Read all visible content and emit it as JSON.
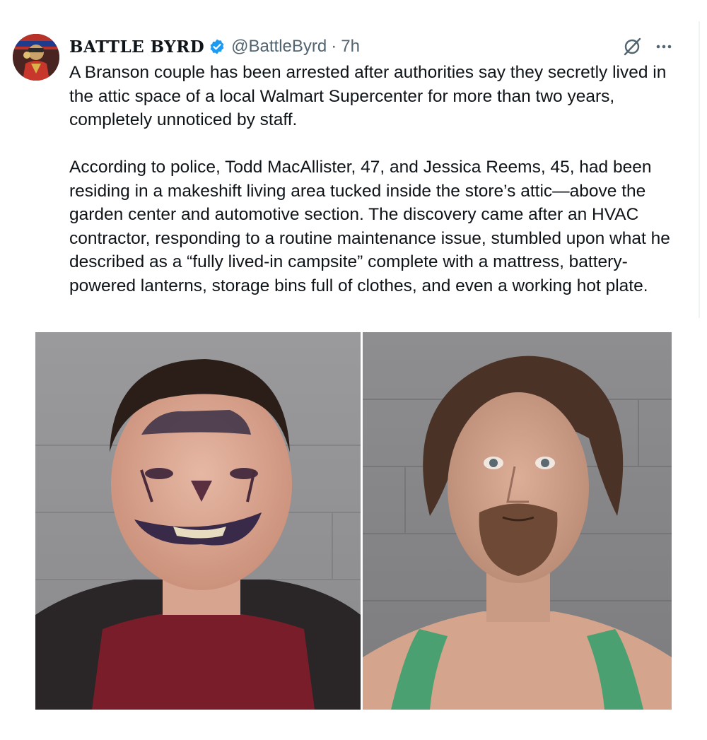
{
  "tweet": {
    "display_name": "BATTLE BYRD",
    "handle": "@BattleByrd",
    "separator": "·",
    "timestamp": "7h",
    "paragraphs": [
      "A Branson couple has been arrested after authorities say they secretly lived in the attic space of a local Walmart Supercenter for more than two years, completely unnoticed by staff.",
      "According to police, Todd MacAllister, 47, and Jessica Reems, 45, had been residing in a makeshift living area tucked inside the store’s attic—above the garden center and automotive section. The discovery came after an HVAC contractor, responding to a routine maintenance issue, stumbled upon what he described as a “fully lived-in campsite” complete with a mattress, battery-powered lanterns, storage bins full of clothes, and even a working hot plate."
    ],
    "icons": {
      "verified": "verified-badge-icon",
      "grok": "grok-icon",
      "more": "more-options-icon"
    },
    "colors": {
      "text": "#0f1419",
      "secondary": "#536471",
      "verified": "#1d9bf0"
    },
    "media": {
      "left_photo": "booking-photo-woman",
      "right_photo": "booking-photo-man"
    }
  }
}
